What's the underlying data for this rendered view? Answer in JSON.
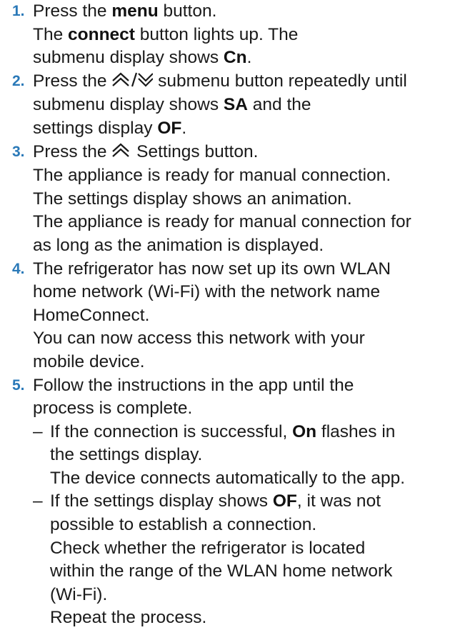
{
  "steps": [
    {
      "number": "1.",
      "l1_a": "Press the ",
      "l1_b": "menu",
      "l1_c": " button.",
      "l2_a": "The ",
      "l2_b": "connect",
      "l2_c": " button lights up. The",
      "l3_a": "submenu display shows ",
      "l3_b": "Cn",
      "l3_c": "."
    },
    {
      "number": "2.",
      "l1_a": "Press the ",
      "l1_c": " submenu button repeatedly until",
      "l2_a": "submenu display shows ",
      "l2_b": "SA",
      "l2_c": " and the",
      "l3_a": "settings display ",
      "l3_b": "OF",
      "l3_c": "."
    },
    {
      "number": "3.",
      "l1_a": "Press the ",
      "l1_c": " Settings button.",
      "l2": "The appliance is ready for manual connection.",
      "l3": "The settings display shows an animation.",
      "l4": "The appliance is ready for manual connection for",
      "l5": "as long as the animation is displayed."
    },
    {
      "number": "4.",
      "l1": "The refrigerator has now set up its own WLAN",
      "l2": "home network (Wi-Fi) with the network name",
      "l3": "HomeConnect.",
      "l4": "You can now access this network with your",
      "l5": "mobile device."
    },
    {
      "number": "5.",
      "l1": "Follow the instructions in the app until the",
      "l2": "process is complete.",
      "sub": [
        {
          "dash": "–",
          "l1_a": "If the connection is successful, ",
          "l1_b": "On",
          "l1_c": " flashes in",
          "l2": "the settings display.",
          "l3": "The device connects automatically to the app."
        },
        {
          "dash": "–",
          "l1_a": "If the settings display shows ",
          "l1_b": "OF",
          "l1_c": ", it was not",
          "l2": "possible to establish a connection.",
          "l3": "Check whether the refrigerator is located",
          "l4": "within the range of the WLAN home network",
          "l5": "(Wi-Fi).",
          "l6": "Repeat the process."
        }
      ]
    }
  ],
  "icons": {
    "up_down": "chevron-double-up-down-icon",
    "up": "chevron-double-up-icon"
  }
}
